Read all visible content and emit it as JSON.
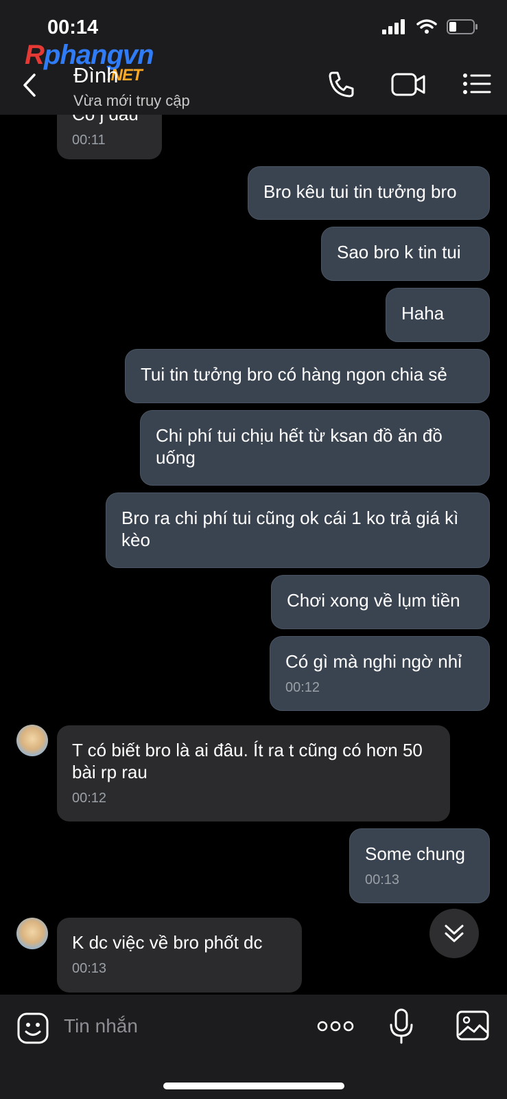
{
  "status_bar": {
    "time": "00:14"
  },
  "watermark": {
    "text_red": "R",
    "text_blue": "phangvn",
    "text_net": ".NET"
  },
  "header": {
    "contact_name": "Đình",
    "contact_status": "Vừa mới truy cập"
  },
  "messages": [
    {
      "side": "in",
      "text": "Có j đâu",
      "time": "00:11"
    },
    {
      "side": "out",
      "text": "Bro kêu tui tin tưởng bro"
    },
    {
      "side": "out",
      "text": "Sao bro k tin tui"
    },
    {
      "side": "out",
      "text": "Haha"
    },
    {
      "side": "out",
      "text": "Tui tin tưởng bro có hàng ngon chia sẻ"
    },
    {
      "side": "out",
      "text": "Chi phí tui chịu hết từ ksan đồ ăn đồ uống"
    },
    {
      "side": "out",
      "text": "Bro ra chi phí tui cũng ok cái 1 ko trả giá kì kèo"
    },
    {
      "side": "out",
      "text": "Chơi xong về lụm tiền"
    },
    {
      "side": "out",
      "text": "Có gì mà nghi ngờ nhỉ",
      "time": "00:12"
    },
    {
      "side": "in",
      "text": "T có biết bro là ai đâu. Ít ra t cũng có hơn 50 bài rp rau",
      "time": "00:12"
    },
    {
      "side": "out",
      "text": "Some chung",
      "time": "00:13"
    },
    {
      "side": "in",
      "text": "K dc việc về bro phốt dc",
      "time": "00:13"
    }
  ],
  "input": {
    "placeholder": "Tin nhắn"
  },
  "colors": {
    "outgoing_bubble": "#3a4350",
    "incoming_bubble": "#2b2b2d",
    "header_bg": "#1c1c1e"
  },
  "icons": [
    "back-icon",
    "phone-icon",
    "video-icon",
    "menu-icon",
    "emoji-icon",
    "more-icon",
    "mic-icon",
    "image-icon",
    "chevron-double-down-icon"
  ]
}
